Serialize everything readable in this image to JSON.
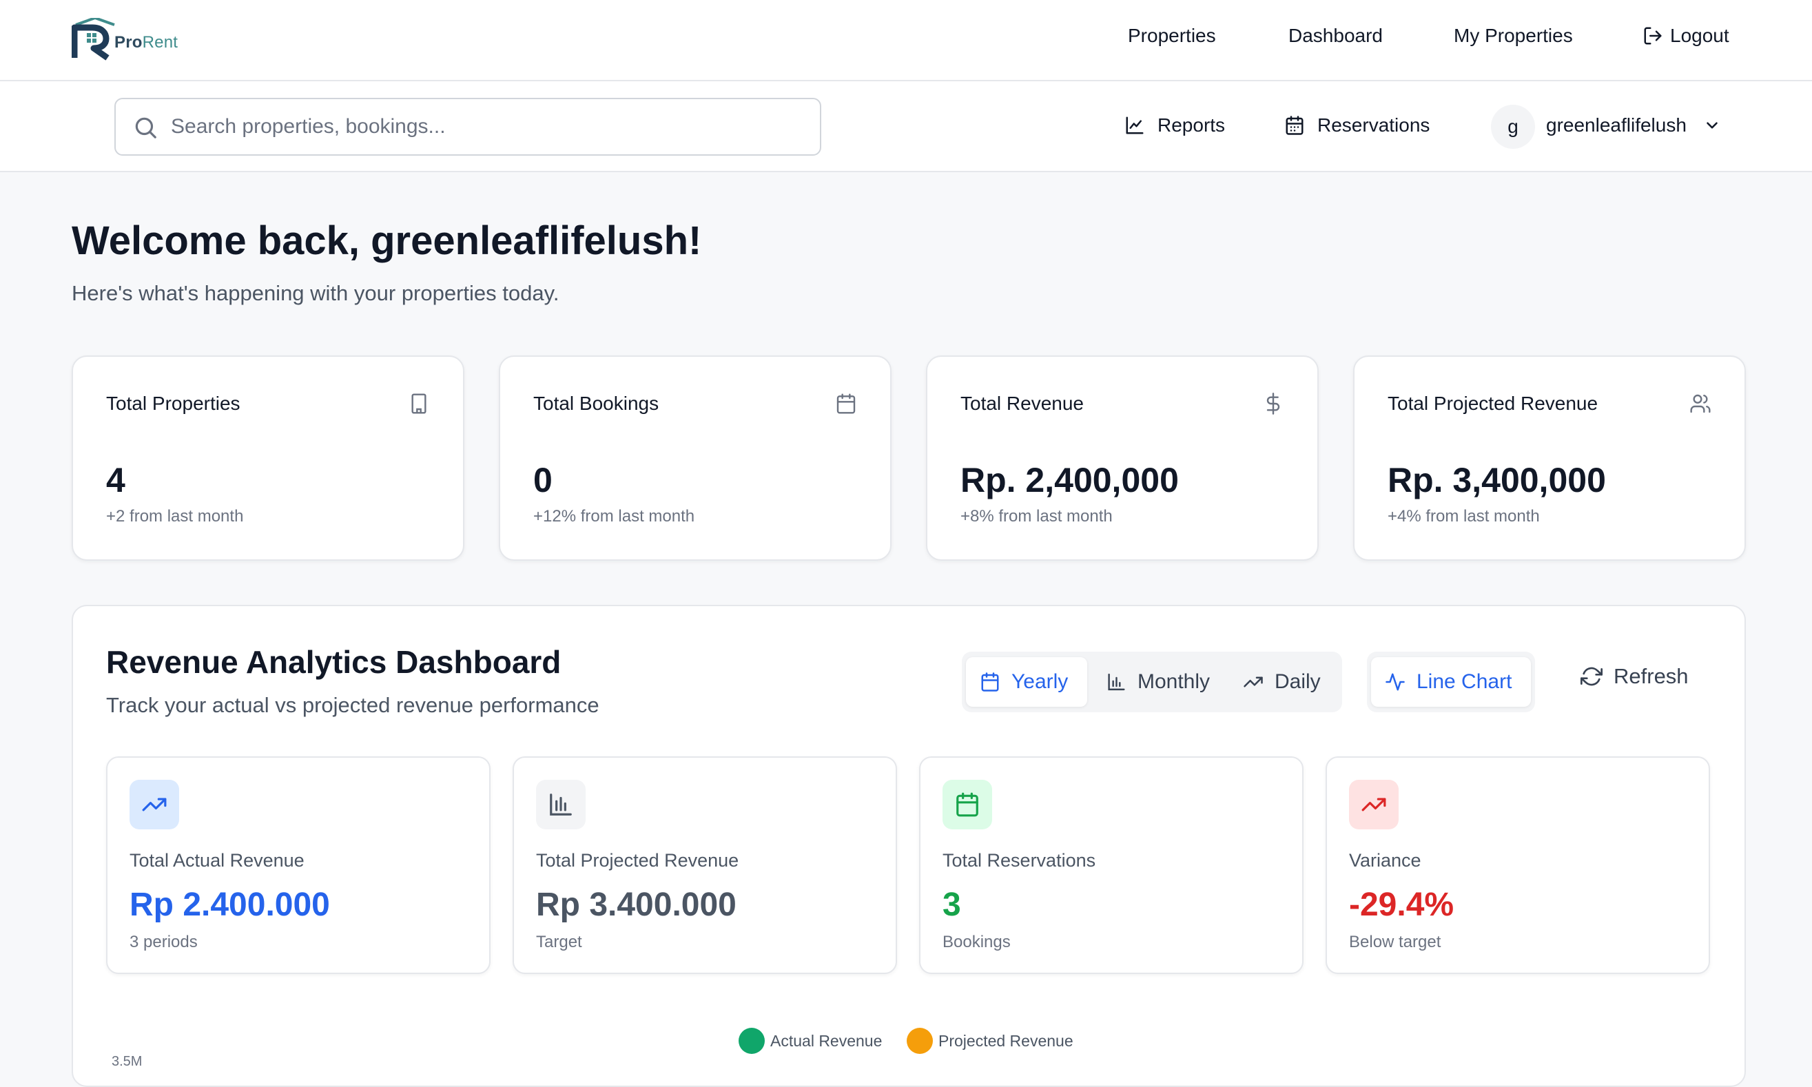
{
  "brand": {
    "pro": "Pro",
    "rent": "Rent"
  },
  "nav": {
    "properties": "Properties",
    "dashboard": "Dashboard",
    "my_properties": "My Properties",
    "logout": "Logout"
  },
  "subbar": {
    "search_placeholder": "Search properties, bookings...",
    "reports": "Reports",
    "reservations": "Reservations",
    "avatar_initial": "g",
    "username": "greenleaflifelush"
  },
  "welcome": {
    "title": "Welcome back, greenleaflifelush!",
    "subtitle": "Here's what's happening with your properties today."
  },
  "stats": [
    {
      "title": "Total Properties",
      "value": "4",
      "delta": "+2 from last month",
      "icon": "building-icon"
    },
    {
      "title": "Total Bookings",
      "value": "0",
      "delta": "+12% from last month",
      "icon": "calendar-icon"
    },
    {
      "title": "Total Revenue",
      "value": "Rp. 2,400,000",
      "delta": "+8% from last month",
      "icon": "dollar-icon"
    },
    {
      "title": "Total Projected Revenue",
      "value": "Rp. 3,400,000",
      "delta": "+4% from last month",
      "icon": "users-icon"
    }
  ],
  "analytics": {
    "title": "Revenue Analytics Dashboard",
    "subtitle": "Track your actual vs projected revenue performance",
    "periods": [
      "Yearly",
      "Monthly",
      "Daily"
    ],
    "active_period": "Yearly",
    "chart_type": "Line Chart",
    "refresh": "Refresh",
    "metrics": [
      {
        "label": "Total Actual Revenue",
        "value": "Rp 2.400.000",
        "foot": "3 periods",
        "color": "#2563eb",
        "icon_bg": "#dbeafe"
      },
      {
        "label": "Total Projected Revenue",
        "value": "Rp 3.400.000",
        "foot": "Target",
        "color": "#4b5563",
        "icon_bg": "#f3f4f6"
      },
      {
        "label": "Total Reservations",
        "value": "3",
        "foot": "Bookings",
        "color": "#16a34a",
        "icon_bg": "#dcfce7"
      },
      {
        "label": "Variance",
        "value": "-29.4%",
        "foot": "Below target",
        "color": "#dc2626",
        "icon_bg": "#fee2e2"
      }
    ],
    "legend": [
      {
        "name": "Actual Revenue",
        "color": "#10a66a"
      },
      {
        "name": "Projected Revenue",
        "color": "#f59e0b"
      }
    ],
    "y_tick_top": "3.5M"
  }
}
